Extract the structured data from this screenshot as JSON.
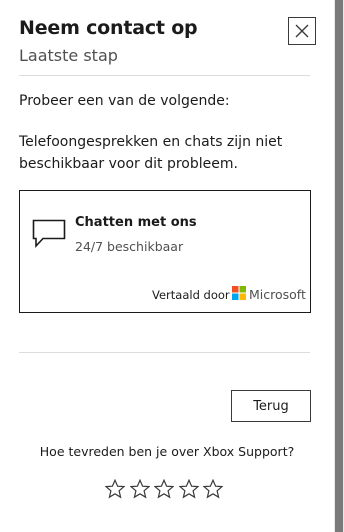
{
  "header": {
    "title": "Neem contact op",
    "subtitle": "Laatste stap",
    "close_icon": "close-icon"
  },
  "content": {
    "intro": "Probeer een van de volgende:",
    "notice": "Telefoongesprekken en chats zijn niet beschikbaar voor dit probleem."
  },
  "chat_option": {
    "icon": "chat-bubble-icon",
    "title": "Chatten met ons",
    "availability": "24/7 beschikbaar",
    "translated_by": "Vertaald door",
    "translator": "Microsoft",
    "logo_colors": [
      "#f25022",
      "#7fba00",
      "#00a4ef",
      "#ffb900"
    ]
  },
  "actions": {
    "back_label": "Terug"
  },
  "rating": {
    "question": "Hoe tevreden ben je over Xbox Support?",
    "stars": [
      "star-icon",
      "star-icon",
      "star-icon",
      "star-icon",
      "star-icon"
    ],
    "selected": 0
  }
}
